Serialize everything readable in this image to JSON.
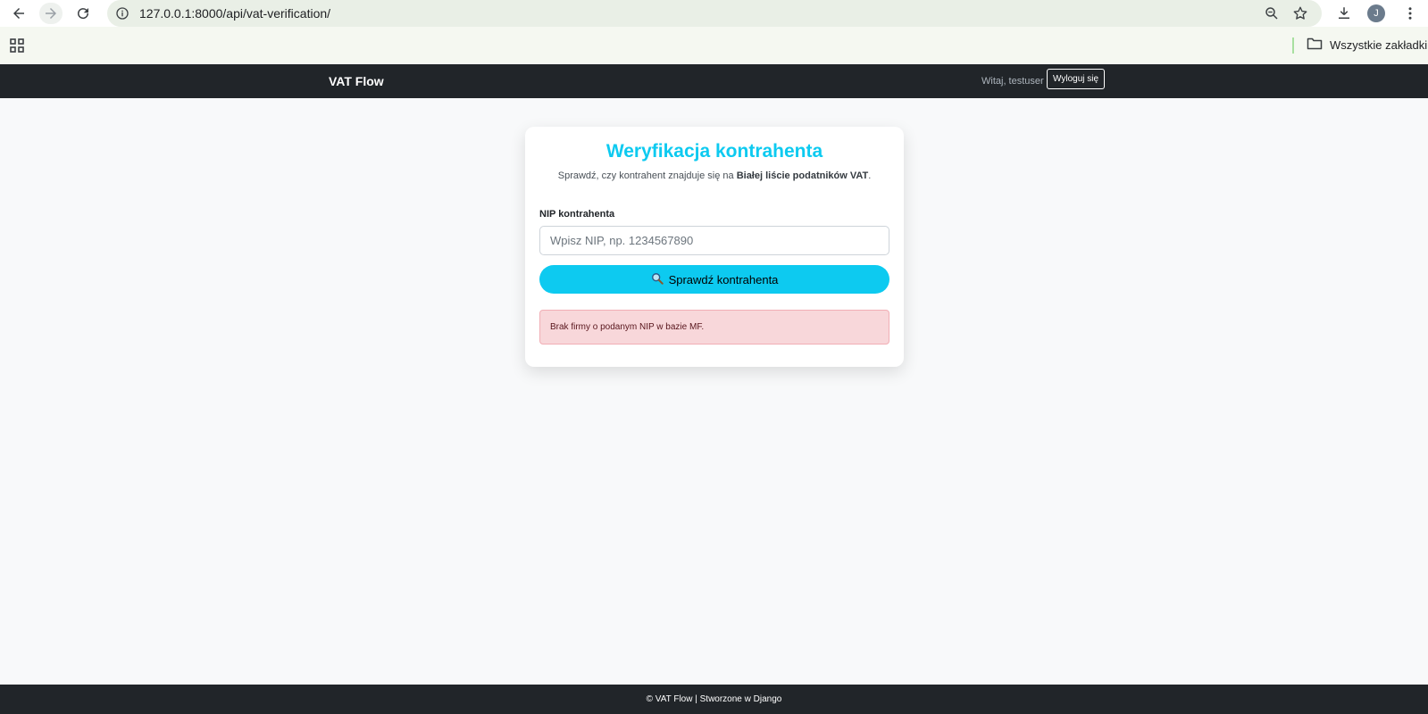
{
  "browser": {
    "url": "127.0.0.1:8000/api/vat-verification/",
    "bookmarks_all_label": "Wszystkie zakładki",
    "profile_initial": "J"
  },
  "navbar": {
    "brand": "VAT Flow",
    "welcome": "Witaj, testuser",
    "logout_label": "Wyloguj się"
  },
  "card": {
    "title": "Weryfikacja kontrahenta",
    "subtitle_prefix": "Sprawdź, czy kontrahent znajduje się na ",
    "subtitle_bold": "Białej liście podatników VAT",
    "subtitle_suffix": ".",
    "nip_label": "NIP kontrahenta",
    "nip_value": "",
    "nip_placeholder": "Wpisz NIP, np. 1234567890",
    "check_button_label": "Sprawdź kontrahenta",
    "alert_message": "Brak firmy o podanym NIP w bazie MF."
  },
  "footer": {
    "text": "© VAT Flow | Stworzone w Django"
  },
  "colors": {
    "accent": "#0dcaf0",
    "navbar_bg": "#212529",
    "alert_bg": "#f8d7da",
    "alert_text": "#58151c"
  }
}
